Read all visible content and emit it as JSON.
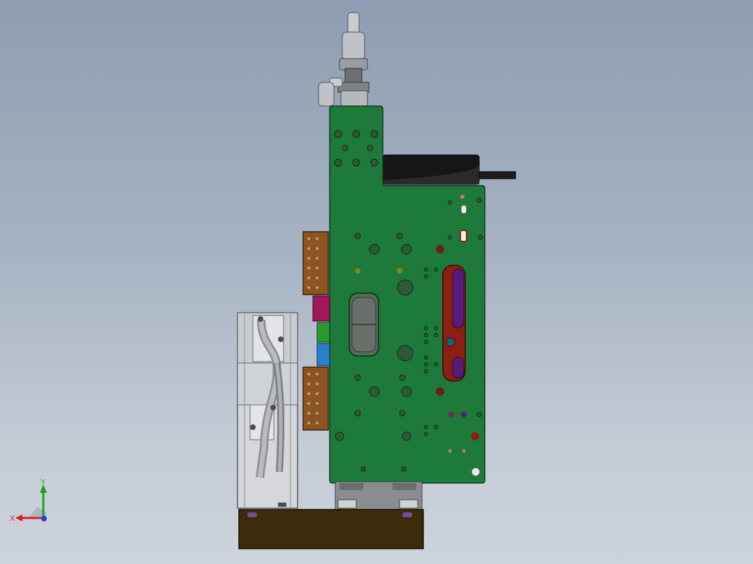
{
  "viewport": {
    "background_top": "#8e9db2",
    "background_bottom": "#cdd3da"
  },
  "model": {
    "plate_color": "#1d7a3a",
    "bracket_color": "#8a5520",
    "slot_color": "#8b2010",
    "slot_accent": "#5a1a7a",
    "base_color": "#3c2c0c",
    "motor_color": "#d5d7da"
  },
  "triad": {
    "x_label": "X",
    "y_label": "Y",
    "x_color": "#d42020",
    "y_color": "#20a020",
    "z_color": "#2040d0"
  }
}
